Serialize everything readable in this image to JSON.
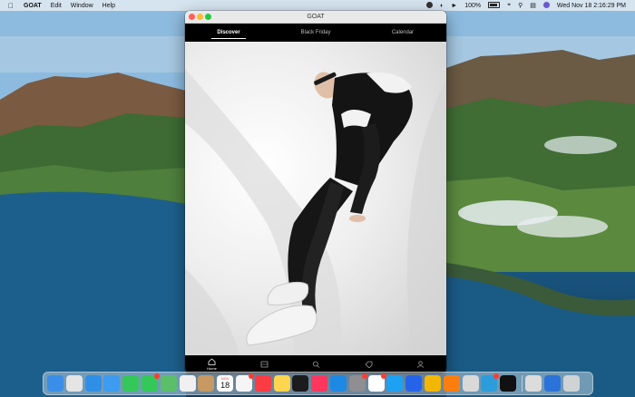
{
  "menubar": {
    "app_name": "GOAT",
    "menus": [
      "Edit",
      "Window",
      "Help"
    ],
    "battery": "100%",
    "datetime": "Wed Nov 18  2:16:29 PM"
  },
  "window": {
    "title": "GOAT",
    "tabs": [
      {
        "label": "Discover",
        "active": true
      },
      {
        "label": "Black Friday",
        "active": false
      },
      {
        "label": "Calendar",
        "active": false
      }
    ],
    "bottom_nav": [
      {
        "icon": "home-icon",
        "label": "Home",
        "active": true
      },
      {
        "icon": "box-icon",
        "label": "",
        "active": false
      },
      {
        "icon": "search-icon",
        "label": "",
        "active": false
      },
      {
        "icon": "tag-icon",
        "label": "",
        "active": false
      },
      {
        "icon": "profile-icon",
        "label": "",
        "active": false
      }
    ]
  },
  "dock": {
    "calendar_month": "NOV",
    "calendar_day": "18",
    "apps": [
      {
        "name": "finder",
        "color": "#3b8ee8"
      },
      {
        "name": "launchpad",
        "color": "#e5e5e5"
      },
      {
        "name": "safari",
        "color": "#2f8fe6"
      },
      {
        "name": "mail",
        "color": "#3d9bf0"
      },
      {
        "name": "facetime",
        "color": "#35c759"
      },
      {
        "name": "messages",
        "color": "#34c759"
      },
      {
        "name": "maps",
        "color": "#5bbf6a"
      },
      {
        "name": "photos",
        "color": "#f0f0f0"
      },
      {
        "name": "contacts",
        "color": "#c69a62"
      },
      {
        "name": "calendar",
        "color": "#ffffff"
      },
      {
        "name": "reminders",
        "color": "#f5f5f5"
      },
      {
        "name": "music",
        "color": "#fc3c44"
      },
      {
        "name": "notes",
        "color": "#ffd54f"
      },
      {
        "name": "tv",
        "color": "#1c1c1e"
      },
      {
        "name": "news",
        "color": "#ff375f"
      },
      {
        "name": "app-store",
        "color": "#1e88e5"
      },
      {
        "name": "system-preferences",
        "color": "#8e8e93"
      },
      {
        "name": "slack",
        "color": "#ffffff"
      },
      {
        "name": "twitter",
        "color": "#1da1f2"
      },
      {
        "name": "tasks",
        "color": "#2563eb"
      },
      {
        "name": "tes",
        "color": "#f2b705"
      },
      {
        "name": "overcast",
        "color": "#fc7e0f"
      },
      {
        "name": "preview",
        "color": "#d9d9d9"
      },
      {
        "name": "tweetbot",
        "color": "#2d9cdb"
      },
      {
        "name": "goat",
        "color": "#111111"
      },
      {
        "name": "downloads",
        "color": "#dcdcdc"
      },
      {
        "name": "screen-time",
        "color": "#2b73d9"
      },
      {
        "name": "trash",
        "color": "#cfd3d6"
      }
    ]
  }
}
